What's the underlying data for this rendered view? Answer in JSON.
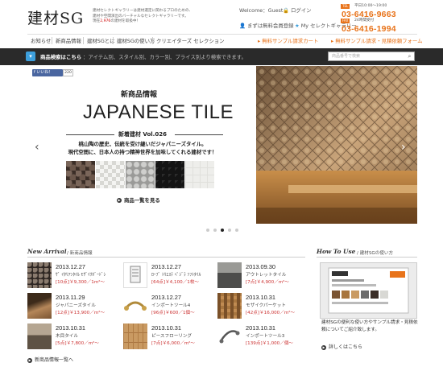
{
  "header": {
    "logo": "建材SG",
    "tagline_1": "建材セレクトギャラリーは建材選定に関わるプロのための、",
    "tagline_2": "建材や空間演出のバーチャルなセレクトギャラリーです。",
    "tagline_3a": "現在",
    "tagline_count": "2,976",
    "tagline_3b": "の建材を取扱中！",
    "welcome": "Welcome：Guest",
    "login": "ログイン",
    "register": "まずは無料会員登録",
    "my_gallery": "My セレクトギャラリー",
    "tel": [
      {
        "tag": "TEL",
        "hours": "平日10:00〜19:00",
        "number": "03-6416-9663"
      },
      {
        "tag": "FAX",
        "hours": "24時間受付",
        "number": "03-6416-1994"
      }
    ]
  },
  "nav": {
    "items": [
      "お知らせ",
      "新商品情報",
      "建材SGとは",
      "建材SGの使い方",
      "クリエイターズ セレクション"
    ],
    "sample_cart": "無料サンプル請求カート",
    "sample_form": "無料サンプル請求・見積依頼フォーム"
  },
  "search": {
    "lead": "商品検索はこちら",
    "desc": "：アイテム別、スタイル別、カラー別、プライス別より検索できます。",
    "placeholder": "商品番号で検索"
  },
  "hero": {
    "like_label": "いいね！",
    "like_count": "220",
    "kicker": "新商品情報",
    "title": "JAPANESE TILE",
    "vol": "新着建材 Vol.026",
    "desc_1": "桃山陶の歴史、伝統を受け継いだジャパニーズタイル。",
    "desc_2": "現代空間に、日本人の持つ精神世界を加味してくれる建材です！",
    "more": "商品一覧を見る",
    "slide_count": 5,
    "active_slide": 3
  },
  "new_arrival": {
    "title_en": "New Arrival",
    "title_jp": "/ 新商品情報",
    "items": [
      {
        "date": "2013.12.27",
        "name": "ｻﾞ ｲﾀﾘｱﾝﾀｲﾙ ﾓｻﾞｲｸﾎﾞｰﾄﾞｼ",
        "price": "[10点]￥9,300／1m²〜"
      },
      {
        "date": "2013.12.27",
        "name": "ﾛｰﾌﾞ ﾄﾘｴｽﾃ ﾍﾟｼﾞﾗ ｿﾌﾄﾀｲﾙ",
        "price": "[64点]￥4,100／1枚〜"
      },
      {
        "date": "2013.09.30",
        "name": "アウトレットタイル",
        "price": "[7点]￥4,900／m²〜"
      },
      {
        "date": "2013.11.29",
        "name": "ジャパニーズタイル",
        "price": "[12点]￥13,900／m²〜"
      },
      {
        "date": "2013.12.27",
        "name": "インポートツール4",
        "price": "[96点]￥600／1個〜"
      },
      {
        "date": "2013.10.31",
        "name": "モザイクパーケット",
        "price": "[42点]￥16,000／m²〜"
      },
      {
        "date": "2013.10.31",
        "name": "木目タイル",
        "price": "[5点]￥7,800／m²〜"
      },
      {
        "date": "2013.10.31",
        "name": "ピースフローリング",
        "price": "[7点]￥6,000／m²〜"
      },
      {
        "date": "2013.10.31",
        "name": "インポートツール3",
        "price": "[139点]￥1,000／個〜"
      }
    ],
    "more": "新商品情報一覧へ"
  },
  "how_to_use": {
    "title_en": "How To Use",
    "title_jp": "/ 建材SGの使い方",
    "text": "建材SGの便利な使い方やサンプル請求・見積依頼についてご紹介致します。",
    "more": "詳しくはこちら"
  },
  "colors": {
    "orange": "#e8731a",
    "dark_bar": "#2a2a2a",
    "accent_blue": "#3d9fdc",
    "price_red": "#cc3333"
  }
}
